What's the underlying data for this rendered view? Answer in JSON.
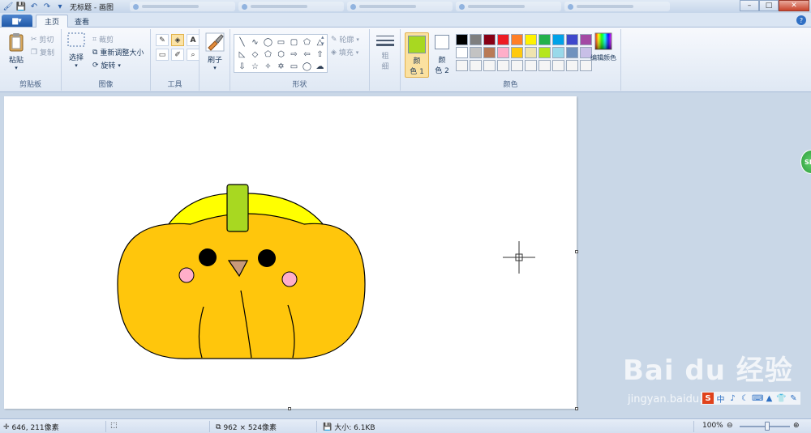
{
  "window": {
    "title": "无标题 - 画图",
    "controls": [
      "–",
      "□",
      "✕"
    ]
  },
  "quick_access": [
    "save-icon",
    "undo-icon",
    "redo-icon",
    "customize-icon"
  ],
  "tabs": {
    "menu": "▆▾",
    "home": "主页",
    "view": "查看"
  },
  "ribbon": {
    "clipboard": {
      "paste": "粘贴",
      "cut": "剪切",
      "copy": "复制",
      "label": "剪贴板"
    },
    "image": {
      "select": "选择",
      "crop": "裁剪",
      "resize": "重新调整大小",
      "rotate": "旋转",
      "label": "图像"
    },
    "tools": {
      "items": [
        "✎",
        "◈",
        "A",
        "▭",
        "✐",
        "⌕"
      ],
      "label": "工具"
    },
    "brushes": {
      "label": "刷子"
    },
    "shapes": {
      "items": [
        "╲",
        "∿",
        "◯",
        "▭",
        "▢",
        "⬠",
        "△",
        "◺",
        "◇",
        "⬠",
        "⬡",
        "⇨",
        "⇦",
        "⇧",
        "⇩",
        "☆",
        "✧",
        "✡",
        "▭",
        "◯",
        "☁"
      ],
      "outline": "轮廓",
      "fill": "填充",
      "label": "形状"
    },
    "size": {
      "label1": "粗",
      "label2": "细"
    },
    "colors": {
      "color1_label_a": "颜",
      "color1_label_b": "色 1",
      "color2_label_a": "颜",
      "color2_label_b": "色 2",
      "color1": "#a8d821",
      "color2": "#ffffff",
      "edit": "编辑颜色",
      "label": "颜色",
      "palette": [
        "#000000",
        "#7f7f7f",
        "#880015",
        "#ed1c24",
        "#ff7f27",
        "#fff200",
        "#22b14c",
        "#00a2e8",
        "#3f48cc",
        "#a349a4",
        "#ffffff",
        "#c3c3c3",
        "#b97a57",
        "#ffaec9",
        "#ffc90e",
        "#efe4b0",
        "#b5e61d",
        "#99d9ea",
        "#7092be",
        "#c8bfe7",
        "#f5f5f5",
        "#f5f5f5",
        "#f5f5f5",
        "#f5f5f5",
        "#f5f5f5",
        "#f5f5f5",
        "#f5f5f5",
        "#f5f5f5",
        "#f5f5f5",
        "#f5f5f5"
      ]
    }
  },
  "drawing": {
    "pumpkin_body": "#ffc60c",
    "pumpkin_top": "#ffff00",
    "stem": "#a8d821",
    "cheeks": "#ffaec9",
    "nose": "#c99a7a"
  },
  "side_badge": "SB",
  "watermark": {
    "main": "Bai du 经验",
    "sub": "jingyan.baidu.com"
  },
  "ime": [
    "S",
    "中",
    "♪",
    "☾",
    "⌨",
    "▲",
    "👕",
    "✎"
  ],
  "status": {
    "cursor": "646, 211像素",
    "selection": "",
    "dimensions": "962 × 524像素",
    "filesize": "大小: 6.1KB",
    "zoom": "100%"
  }
}
